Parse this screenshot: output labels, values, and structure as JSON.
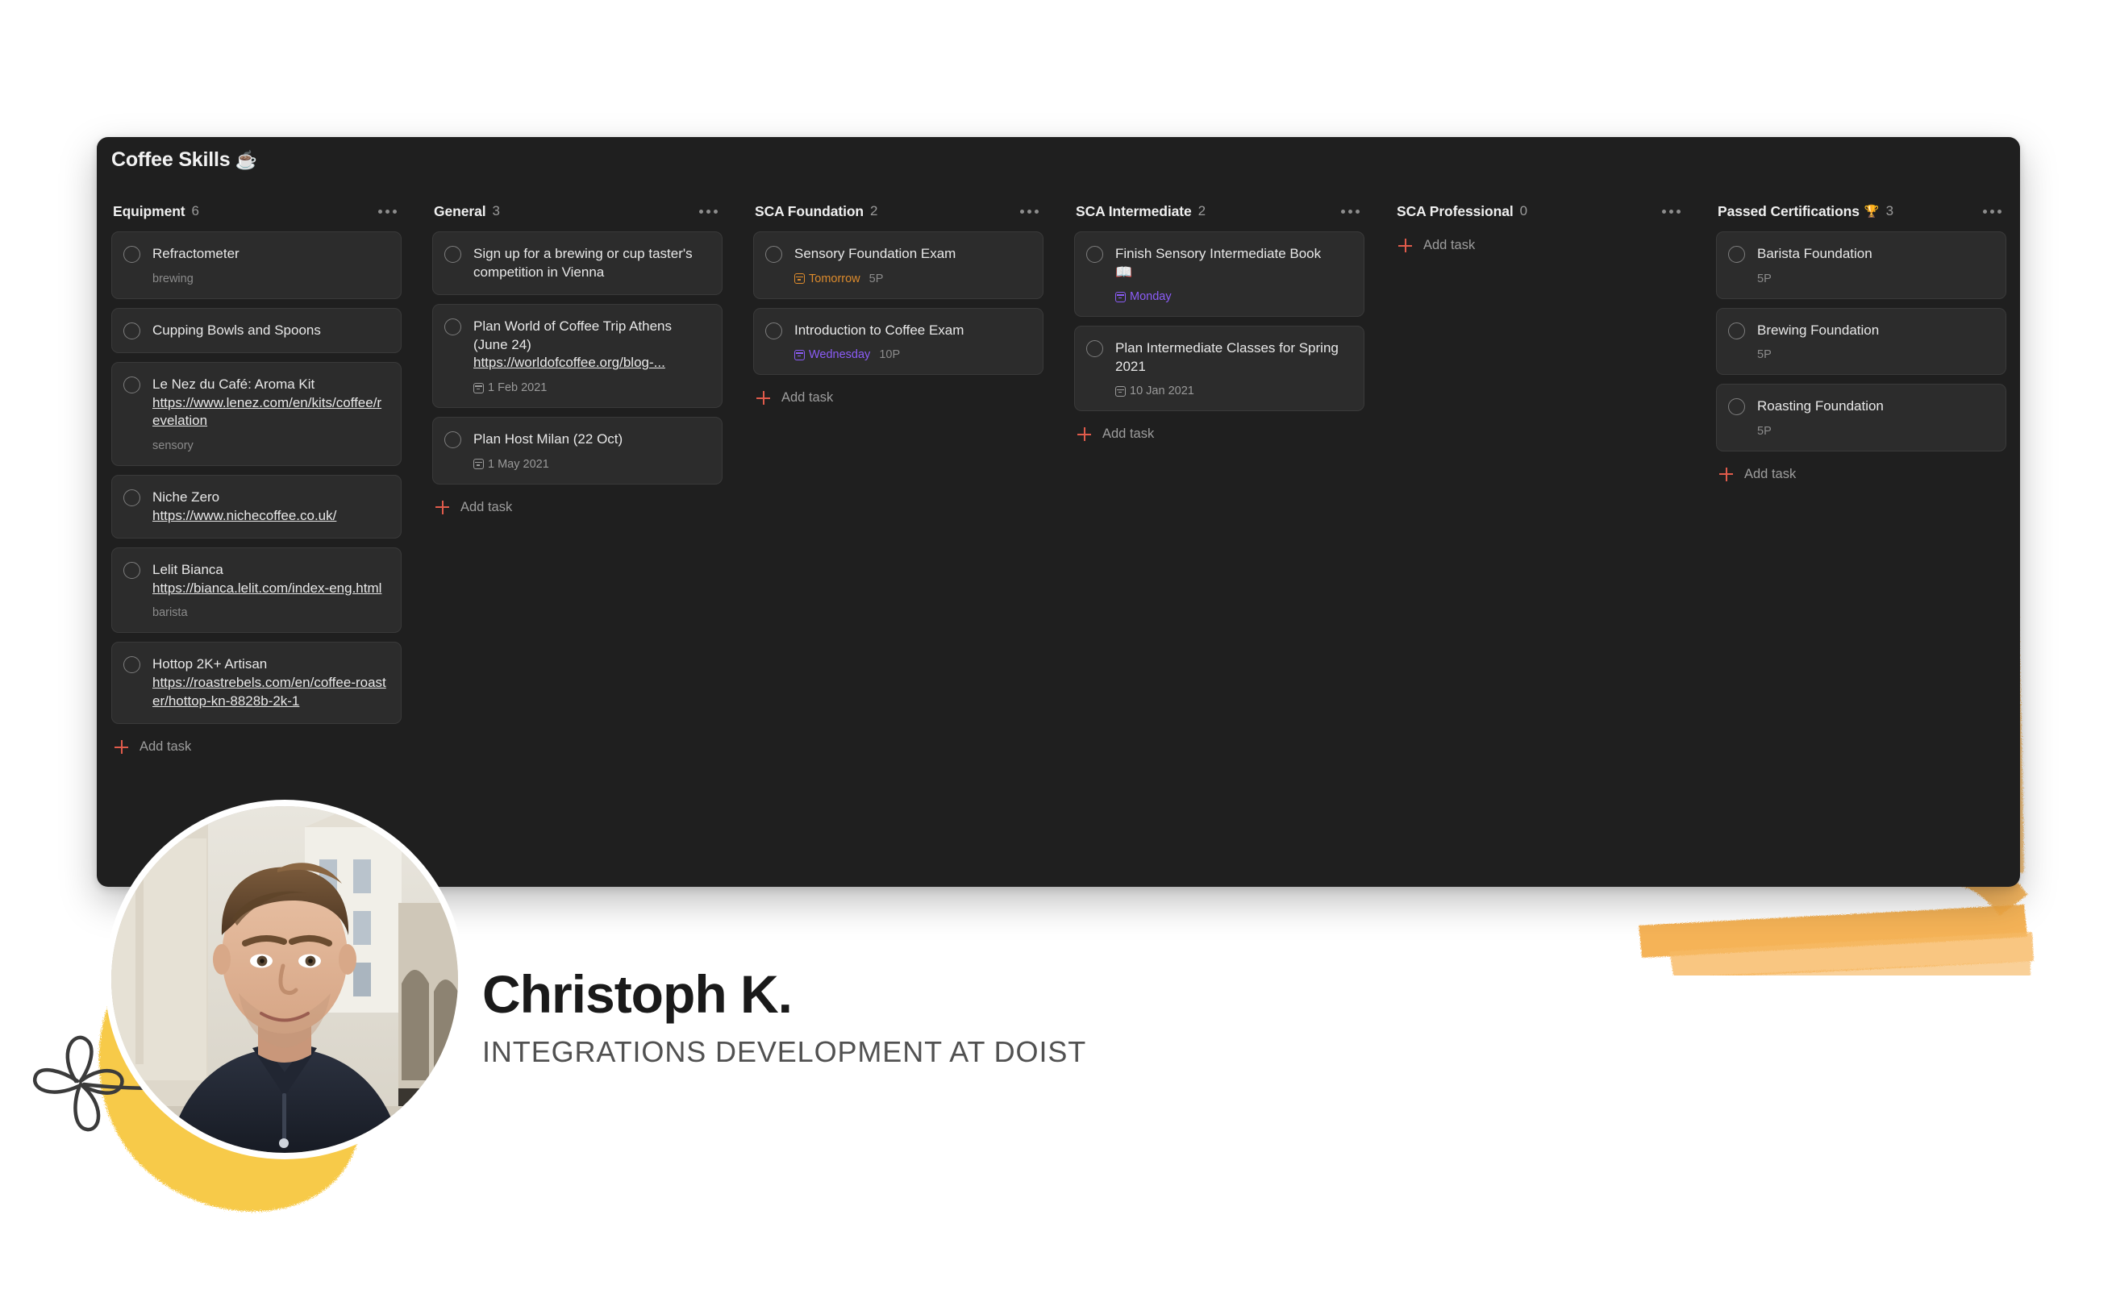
{
  "board": {
    "title": "Coffee Skills",
    "title_emoji": "☕",
    "columns": [
      {
        "name": "Equipment",
        "count": "6",
        "emoji": "",
        "add_task_label": "Add task",
        "tasks": [
          {
            "title": "Refractometer",
            "link": "",
            "label": "brewing",
            "date": "",
            "date_style": "",
            "note": "",
            "emoji": ""
          },
          {
            "title": "Cupping Bowls and Spoons",
            "link": "",
            "label": "",
            "date": "",
            "date_style": "",
            "note": "",
            "emoji": ""
          },
          {
            "title": "Le Nez du Café: Aroma Kit",
            "link": "https://www.lenez.com/en/kits/coffee/revelation",
            "label": "sensory",
            "date": "",
            "date_style": "",
            "note": "",
            "emoji": ""
          },
          {
            "title": "Niche Zero",
            "link": "https://www.nichecoffee.co.uk/",
            "label": "",
            "date": "",
            "date_style": "",
            "note": "",
            "emoji": ""
          },
          {
            "title": "Lelit Bianca",
            "link": "https://bianca.lelit.com/index-eng.html",
            "label": "barista",
            "date": "",
            "date_style": "",
            "note": "",
            "emoji": ""
          },
          {
            "title": "Hottop 2K+ Artisan",
            "link": "https://roastrebels.com/en/coffee-roaster/hottop-kn-8828b-2k-1",
            "label": "",
            "date": "",
            "date_style": "",
            "note": "",
            "emoji": ""
          }
        ]
      },
      {
        "name": "General",
        "count": "3",
        "emoji": "",
        "add_task_label": "Add task",
        "tasks": [
          {
            "title": "Sign up for a brewing or cup taster's competition in Vienna",
            "link": "",
            "label": "",
            "date": "",
            "date_style": "",
            "note": "",
            "emoji": ""
          },
          {
            "title": "Plan World of Coffee Trip Athens (June 24)",
            "link": "https://worldofcoffee.org/blog-...",
            "label": "",
            "date": "1 Feb 2021",
            "date_style": "grey",
            "note": "",
            "emoji": ""
          },
          {
            "title": "Plan Host Milan (22 Oct)",
            "link": "",
            "label": "",
            "date": "1 May 2021",
            "date_style": "grey",
            "note": "",
            "emoji": ""
          }
        ]
      },
      {
        "name": "SCA Foundation",
        "count": "2",
        "emoji": "",
        "add_task_label": "Add task",
        "tasks": [
          {
            "title": "Sensory Foundation Exam",
            "link": "",
            "label": "",
            "date": "Tomorrow",
            "date_style": "orange",
            "note": "5P",
            "emoji": ""
          },
          {
            "title": "Introduction to Coffee Exam",
            "link": "",
            "label": "",
            "date": "Wednesday",
            "date_style": "purple",
            "note": "10P",
            "emoji": ""
          }
        ]
      },
      {
        "name": "SCA Intermediate",
        "count": "2",
        "emoji": "",
        "add_task_label": "Add task",
        "tasks": [
          {
            "title": "Finish Sensory Intermediate Book",
            "link": "",
            "label": "",
            "date": "Monday",
            "date_style": "purple",
            "note": "",
            "emoji": "📖"
          },
          {
            "title": "Plan Intermediate Classes for Spring 2021",
            "link": "",
            "label": "",
            "date": "10 Jan 2021",
            "date_style": "grey",
            "note": "",
            "emoji": ""
          }
        ]
      },
      {
        "name": "SCA Professional",
        "count": "0",
        "emoji": "",
        "add_task_label": "Add task",
        "tasks": []
      },
      {
        "name": "Passed Certifications",
        "count": "3",
        "emoji": "🏆",
        "add_task_label": "Add task",
        "tasks": [
          {
            "title": "Barista Foundation",
            "link": "",
            "label": "5P",
            "date": "",
            "date_style": "",
            "note": "",
            "emoji": ""
          },
          {
            "title": "Brewing Foundation",
            "link": "",
            "label": "5P",
            "date": "",
            "date_style": "",
            "note": "",
            "emoji": ""
          },
          {
            "title": "Roasting Foundation",
            "link": "",
            "label": "5P",
            "date": "",
            "date_style": "",
            "note": "",
            "emoji": ""
          }
        ]
      }
    ]
  },
  "profile": {
    "name": "Christoph K.",
    "role": "INTEGRATIONS DEVELOPMENT AT DOIST"
  },
  "colors": {
    "board_bg": "#1f1f1f",
    "card_bg": "#2c2c2c",
    "accent_red": "#e05b4b",
    "date_orange": "#dd8b2c",
    "date_purple": "#8b5cf6",
    "brush_orange": "#f5ab45",
    "blob_yellow": "#f7c73f"
  }
}
